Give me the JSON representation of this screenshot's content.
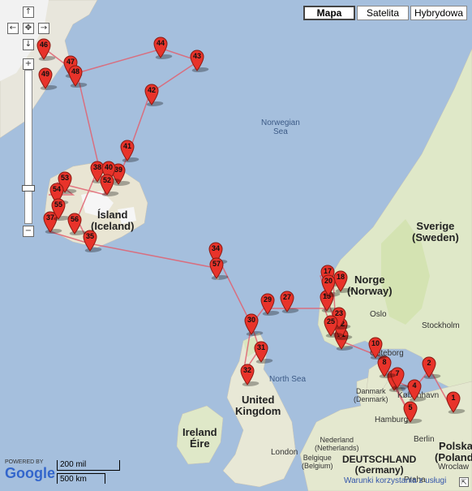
{
  "map_types": {
    "mapa": "Mapa",
    "satelita": "Satelita",
    "hybrydowa": "Hybrydowa",
    "active": "mapa"
  },
  "nav": {
    "up": "↑",
    "left": "←",
    "center": "✥",
    "right": "→",
    "down": "↓",
    "zoom_in": "+",
    "zoom_out": "−"
  },
  "labels": {
    "norwegian_sea": "Norwegian",
    "norwegian_sea2": "Sea",
    "north_sea": "North Sea",
    "island": "Ísland",
    "iceland": "(Iceland)",
    "norge": "Norge",
    "norway": "(Norway)",
    "sverige": "Sverige",
    "sweden": "(Sweden)",
    "uk1": "United",
    "uk2": "Kingdom",
    "ireland": "Ireland",
    "eire": "Éire",
    "danmark": "Danmark",
    "denmark": "(Denmark)",
    "nederland": "Nederland",
    "netherlands": "(Netherlands)",
    "belgique": "Belgique",
    "belgium": "(Belgium)",
    "deutschland": "DEUTSCHLAND",
    "germany": "(Germany)",
    "polska": "Polska",
    "poland": "(Poland)",
    "oslo": "Oslo",
    "stockholm": "Stockholm",
    "goteborg": "Göteborg",
    "kobenhavn": "København",
    "hamburg": "Hamburg",
    "berlin": "Berlin",
    "london": "London",
    "praha": "Praha",
    "wroclaw": "Wroclaw"
  },
  "footer": {
    "powered_by": "POWERED BY",
    "google": "Google",
    "scale_mi": "200 mil",
    "scale_km": "500 km",
    "terms": "Warunki korzystania z usługi"
  },
  "markers": [
    {
      "n": "1"
    },
    {
      "n": "2"
    },
    {
      "n": "4"
    },
    {
      "n": "5"
    },
    {
      "n": "6"
    },
    {
      "n": "7"
    },
    {
      "n": "8"
    },
    {
      "n": "10"
    },
    {
      "n": "11"
    },
    {
      "n": "15"
    },
    {
      "n": "17"
    },
    {
      "n": "18"
    },
    {
      "n": "20"
    },
    {
      "n": "22"
    },
    {
      "n": "23"
    },
    {
      "n": "25"
    },
    {
      "n": "27"
    },
    {
      "n": "29"
    },
    {
      "n": "30"
    },
    {
      "n": "31"
    },
    {
      "n": "32"
    },
    {
      "n": "34"
    },
    {
      "n": "35"
    },
    {
      "n": "37"
    },
    {
      "n": "38"
    },
    {
      "n": "39"
    },
    {
      "n": "40"
    },
    {
      "n": "41"
    },
    {
      "n": "42"
    },
    {
      "n": "43"
    },
    {
      "n": "44"
    },
    {
      "n": "46"
    },
    {
      "n": "47"
    },
    {
      "n": "48"
    },
    {
      "n": "49"
    },
    {
      "n": "52"
    },
    {
      "n": "53"
    },
    {
      "n": "54"
    },
    {
      "n": "55"
    },
    {
      "n": "56"
    },
    {
      "n": "57"
    }
  ]
}
